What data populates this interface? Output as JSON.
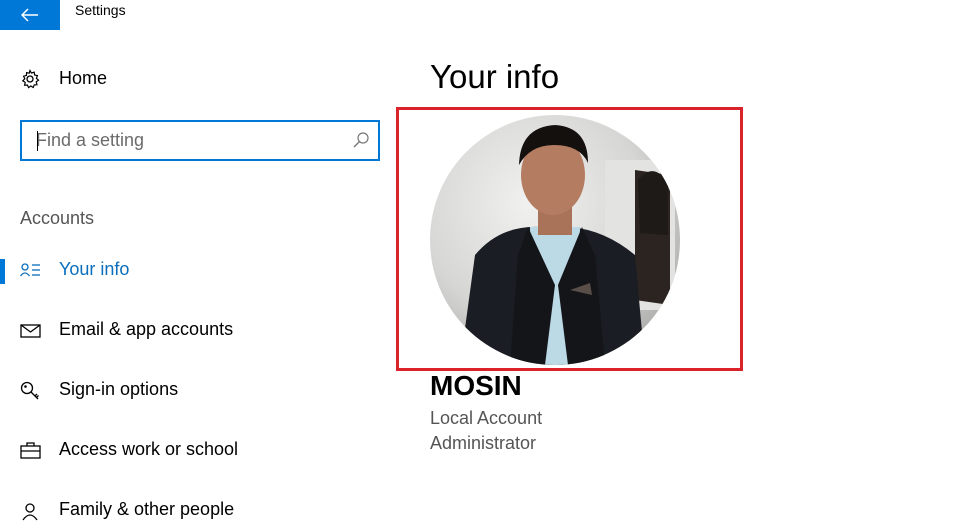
{
  "app": {
    "title": "Settings"
  },
  "sidebar": {
    "home_label": "Home",
    "search_placeholder": "Find a setting",
    "section_title": "Accounts",
    "items": [
      {
        "label": "Your info",
        "icon": "person-list-icon",
        "active": true
      },
      {
        "label": "Email & app accounts",
        "icon": "mail-icon",
        "active": false
      },
      {
        "label": "Sign-in options",
        "icon": "key-icon",
        "active": false
      },
      {
        "label": "Access work or school",
        "icon": "briefcase-icon",
        "active": false
      },
      {
        "label": "Family & other people",
        "icon": "person-icon",
        "active": false
      }
    ]
  },
  "main": {
    "title": "Your info",
    "user": {
      "name": "MOSIN",
      "account_type": "Local Account",
      "role": "Administrator"
    }
  },
  "colors": {
    "accent": "#0078d7",
    "active_text": "#0a6ebd",
    "highlight_border": "#d9222a"
  }
}
